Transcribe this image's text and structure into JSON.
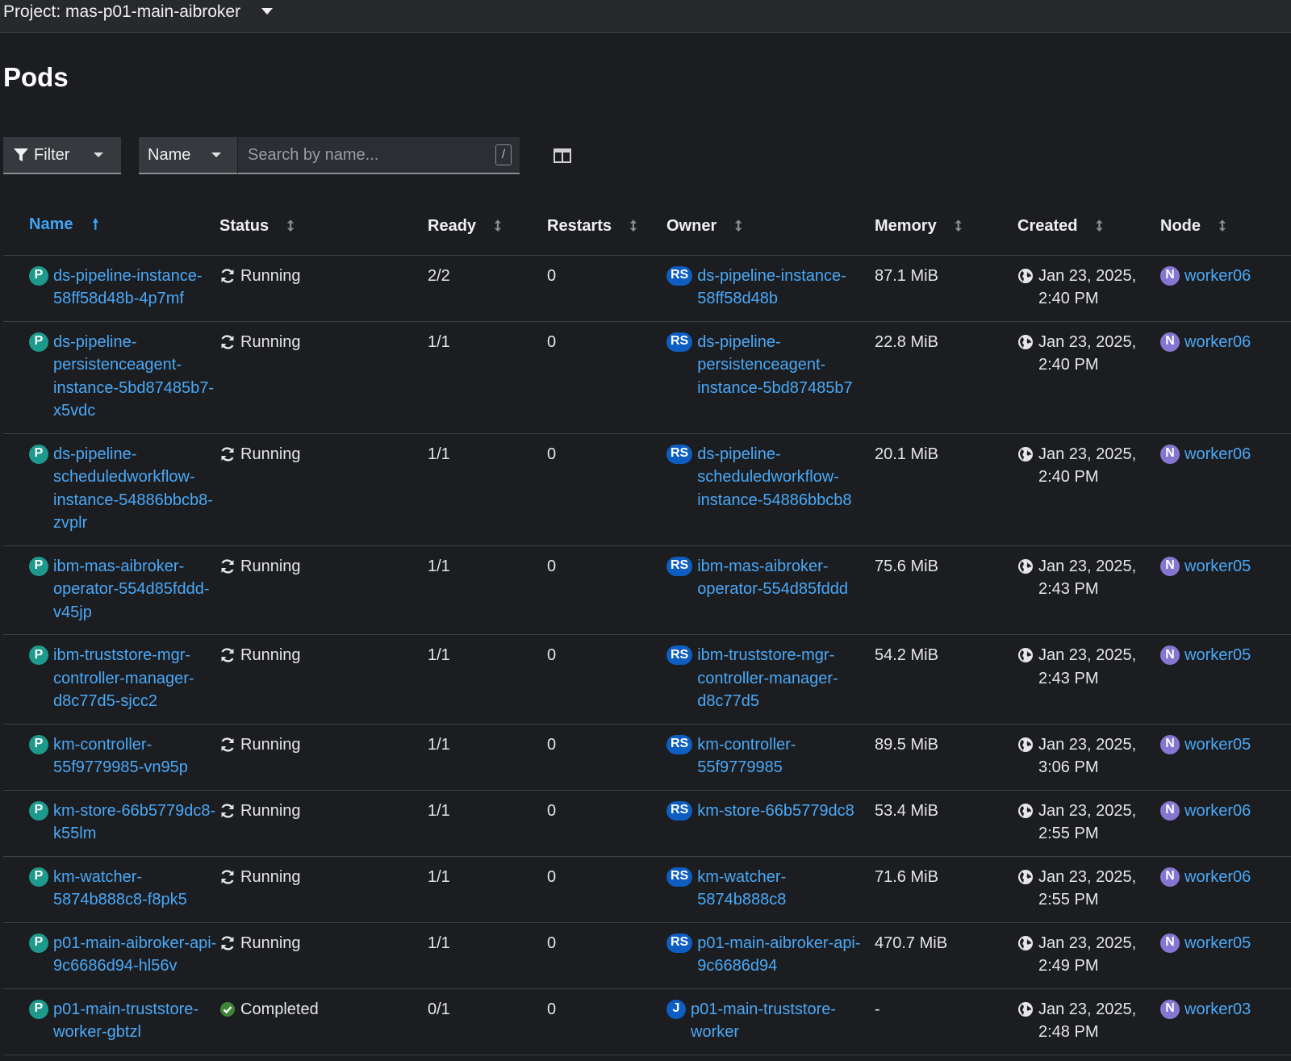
{
  "header": {
    "project_label": "Project: mas-p01-main-aibroker"
  },
  "page": {
    "title": "Pods"
  },
  "toolbar": {
    "filter_label": "Filter",
    "name_select_label": "Name",
    "search_placeholder": "Search by name...",
    "search_shortcut": "/"
  },
  "table": {
    "columns": [
      "Name",
      "Status",
      "Ready",
      "Restarts",
      "Owner",
      "Memory",
      "Created",
      "Node"
    ],
    "rows": [
      {
        "badge": "P",
        "name": "ds-pipeline-instance-58ff58d48b-4p7mf",
        "status": "Running",
        "status_icon": "sync-icon",
        "ready": "2/2",
        "restarts": "0",
        "owner_badge": "RS",
        "owner": "ds-pipeline-instance-58ff58d48b",
        "memory": "87.1 MiB",
        "created": "Jan 23, 2025, 2:40 PM",
        "node_badge": "N",
        "node": "worker06"
      },
      {
        "badge": "P",
        "name": "ds-pipeline-persistenceagent-instance-5bd87485b7-x5vdc",
        "status": "Running",
        "status_icon": "sync-icon",
        "ready": "1/1",
        "restarts": "0",
        "owner_badge": "RS",
        "owner": "ds-pipeline-persistenceagent-instance-5bd87485b7",
        "memory": "22.8 MiB",
        "created": "Jan 23, 2025, 2:40 PM",
        "node_badge": "N",
        "node": "worker06"
      },
      {
        "badge": "P",
        "name": "ds-pipeline-scheduledworkflow-instance-54886bbcb8-zvplr",
        "status": "Running",
        "status_icon": "sync-icon",
        "ready": "1/1",
        "restarts": "0",
        "owner_badge": "RS",
        "owner": "ds-pipeline-scheduledworkflow-instance-54886bbcb8",
        "memory": "20.1 MiB",
        "created": "Jan 23, 2025, 2:40 PM",
        "node_badge": "N",
        "node": "worker06"
      },
      {
        "badge": "P",
        "name": "ibm-mas-aibroker-operator-554d85fddd-v45jp",
        "status": "Running",
        "status_icon": "sync-icon",
        "ready": "1/1",
        "restarts": "0",
        "owner_badge": "RS",
        "owner": "ibm-mas-aibroker-operator-554d85fddd",
        "memory": "75.6 MiB",
        "created": "Jan 23, 2025, 2:43 PM",
        "node_badge": "N",
        "node": "worker05"
      },
      {
        "badge": "P",
        "name": "ibm-truststore-mgr-controller-manager-d8c77d5-sjcc2",
        "status": "Running",
        "status_icon": "sync-icon",
        "ready": "1/1",
        "restarts": "0",
        "owner_badge": "RS",
        "owner": "ibm-truststore-mgr-controller-manager-d8c77d5",
        "memory": "54.2 MiB",
        "created": "Jan 23, 2025, 2:43 PM",
        "node_badge": "N",
        "node": "worker05"
      },
      {
        "badge": "P",
        "name": "km-controller-55f9779985-vn95p",
        "status": "Running",
        "status_icon": "sync-icon",
        "ready": "1/1",
        "restarts": "0",
        "owner_badge": "RS",
        "owner": "km-controller-55f9779985",
        "memory": "89.5 MiB",
        "created": "Jan 23, 2025, 3:06 PM",
        "node_badge": "N",
        "node": "worker05"
      },
      {
        "badge": "P",
        "name": "km-store-66b5779dc8-k55lm",
        "status": "Running",
        "status_icon": "sync-icon",
        "ready": "1/1",
        "restarts": "0",
        "owner_badge": "RS",
        "owner": "km-store-66b5779dc8",
        "memory": "53.4 MiB",
        "created": "Jan 23, 2025, 2:55 PM",
        "node_badge": "N",
        "node": "worker06"
      },
      {
        "badge": "P",
        "name": "km-watcher-5874b888c8-f8pk5",
        "status": "Running",
        "status_icon": "sync-icon",
        "ready": "1/1",
        "restarts": "0",
        "owner_badge": "RS",
        "owner": "km-watcher-5874b888c8",
        "memory": "71.6 MiB",
        "created": "Jan 23, 2025, 2:55 PM",
        "node_badge": "N",
        "node": "worker06"
      },
      {
        "badge": "P",
        "name": "p01-main-aibroker-api-9c6686d94-hl56v",
        "status": "Running",
        "status_icon": "sync-icon",
        "ready": "1/1",
        "restarts": "0",
        "owner_badge": "RS",
        "owner": "p01-main-aibroker-api-9c6686d94",
        "memory": "470.7 MiB",
        "created": "Jan 23, 2025, 2:49 PM",
        "node_badge": "N",
        "node": "worker05"
      },
      {
        "badge": "P",
        "name": "p01-main-truststore-worker-gbtzl",
        "status": "Completed",
        "status_icon": "check-circle-icon",
        "ready": "0/1",
        "restarts": "0",
        "owner_badge": "J",
        "owner": "p01-main-truststore-worker",
        "memory": "-",
        "created": "Jan 23, 2025, 2:48 PM",
        "node_badge": "N",
        "node": "worker03"
      }
    ]
  },
  "colors": {
    "link": "#4ba8f5",
    "pod_badge": "#1d9a8b",
    "owner_badge": "#0d5ec0",
    "node_badge": "#8476d1",
    "completed_green": "#3e8635"
  }
}
